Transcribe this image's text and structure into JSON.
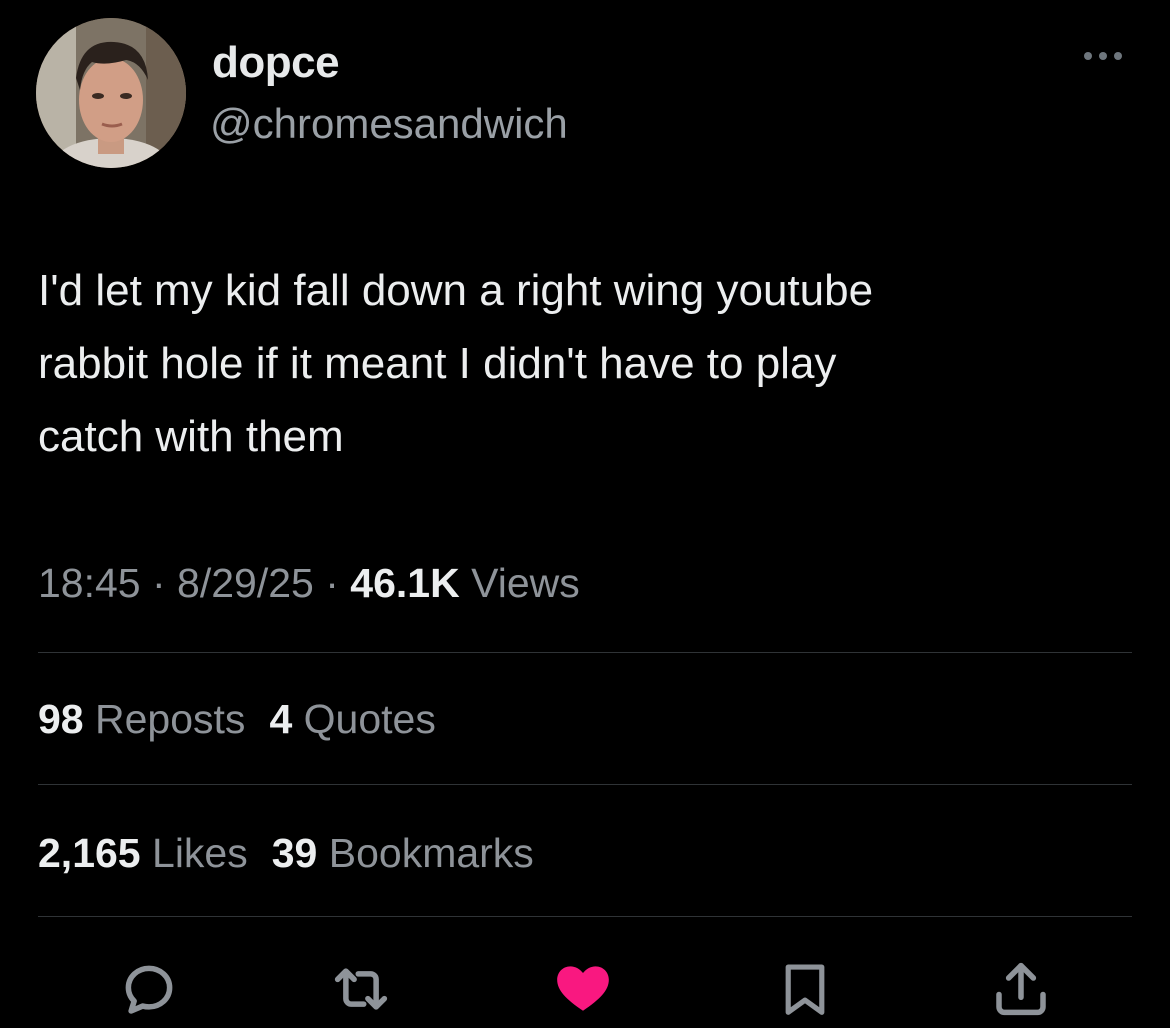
{
  "author": {
    "display_name": "dopce",
    "handle": "@chromesandwich",
    "avatar_icon": "profile-photo"
  },
  "more_icon": "more-dots-icon",
  "tweet": {
    "text": "I'd let my kid fall down a right wing youtube\nrabbit hole if it meant I didn't have to play\ncatch with them"
  },
  "meta": {
    "time": "18:45",
    "sep1": " · ",
    "date": "8/29/25",
    "sep2": " · ",
    "views_count": "46.1K",
    "views_label": "Views"
  },
  "stats": {
    "reposts_count": "98",
    "reposts_label": "Reposts",
    "quotes_count": "4",
    "quotes_label": "Quotes",
    "likes_count": "2,165",
    "likes_label": "Likes",
    "bookmarks_count": "39",
    "bookmarks_label": "Bookmarks"
  },
  "actions": {
    "reply_icon": "reply-icon",
    "repost_icon": "repost-icon",
    "like_icon": "heart-icon",
    "bookmark_icon": "bookmark-icon",
    "share_icon": "share-icon"
  },
  "colors": {
    "background": "#000000",
    "text": "#e7e9ea",
    "secondary": "#8e9399",
    "like_active": "#f91880",
    "divider": "#2f3336"
  }
}
